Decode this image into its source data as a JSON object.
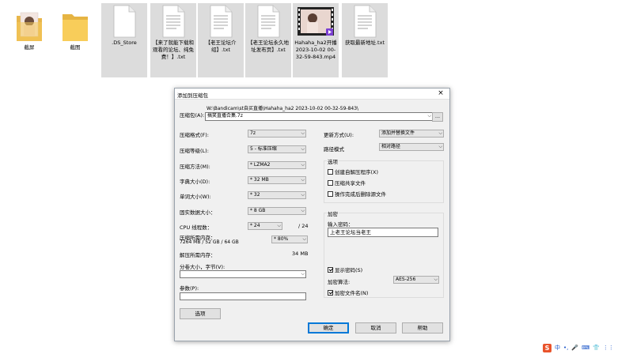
{
  "desktop": {
    "icons": [
      {
        "label": "截屏",
        "type": "folder-photo"
      },
      {
        "label": "截图",
        "type": "folder"
      },
      {
        "label": ".DS_Store",
        "type": "file"
      },
      {
        "label": "【来了就能下载和观看的论坛、纯免费！】.txt",
        "type": "text"
      },
      {
        "label": "【老王论坛介绍】.txt",
        "type": "text"
      },
      {
        "label": "【老王论坛永久地址发布页】.txt",
        "type": "text"
      },
      {
        "label": "Hahaha_ha2开播 2023-10-02 00-32-59-843.mp4",
        "type": "video"
      },
      {
        "label": "获取最新地址.txt",
        "type": "text"
      }
    ]
  },
  "dialog": {
    "title": "添加到压缩包",
    "close": "×",
    "archive_label": "压缩包(A):",
    "archive_path": "W:\\Bandicam\\st自买直播\\Hahaha_ha2 2023-10-02 00-32-59-843\\",
    "archive_name": "搞笑直播合集.7z",
    "browse": "...",
    "left": {
      "format_label": "压缩格式(F):",
      "format_value": "7z",
      "level_label": "压缩等级(L):",
      "level_value": "5 - 标准压缩",
      "method_label": "压缩方法(M):",
      "method_value": "* LZMA2",
      "dict_label": "字典大小(D):",
      "dict_value": "* 32 MB",
      "word_label": "单词大小(W):",
      "word_value": "* 32",
      "solid_label": "固实数据大小：",
      "solid_value": "* 8 GB",
      "cpu_label": "CPU 线程数：",
      "cpu_value": "* 24",
      "cpu_max": "/ 24",
      "memc_label": "压缩所需内存：",
      "memc_detail": "7264 MB / 52 GB / 64 GB",
      "memc_value": "* 80%",
      "memd_label": "解压所需内存：",
      "memd_value": "34 MB",
      "split_label": "分卷大小，字节(V):",
      "params_label": "参数(P):",
      "options_button": "选项"
    },
    "right": {
      "update_label": "更新方式(U):",
      "update_value": "添加并替换文件",
      "path_label": "路径模式",
      "path_value": "相对路径",
      "options_group": "选项",
      "opt_sfx": "创建自解压程序(X)",
      "opt_shared": "压缩共享文件",
      "opt_delete": "操作完成后删除源文件",
      "encrypt_group": "加密",
      "password_label": "输入密码：",
      "password_value": "上老王论坛当老王",
      "show_password": "显示密码(S)",
      "method_label": "加密算法:",
      "method_value": "AES-256",
      "encrypt_names": "加密文件名(N)"
    },
    "buttons": {
      "ok": "确定",
      "cancel": "取消",
      "help": "帮助"
    }
  },
  "tray": {
    "ime_logo": "S",
    "ime_lang": "中",
    "items": [
      "•,",
      "🎤",
      "⌨",
      "👕",
      "⋮⋮"
    ]
  }
}
